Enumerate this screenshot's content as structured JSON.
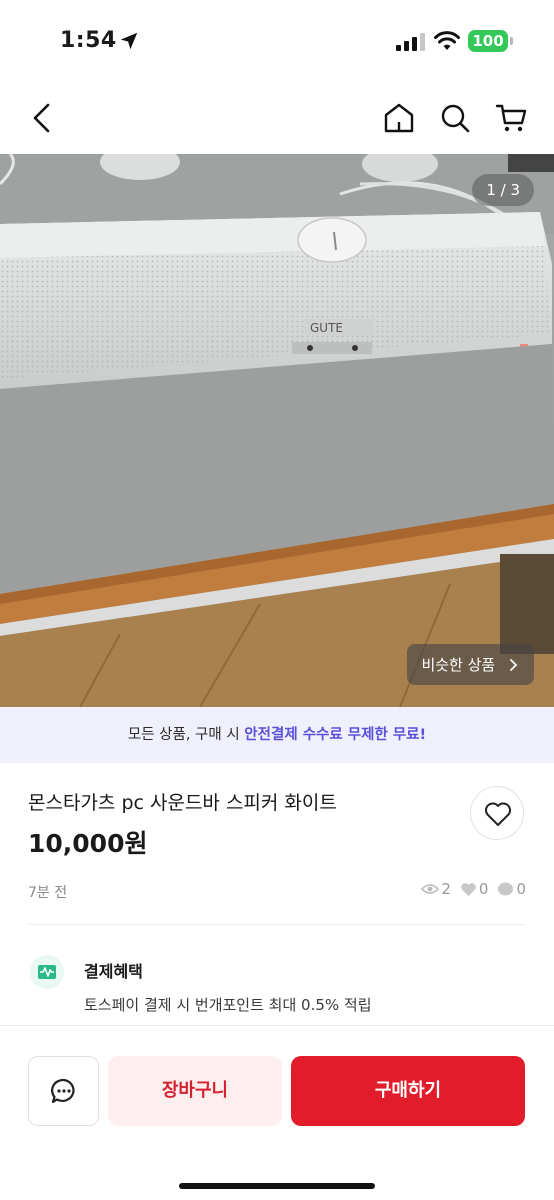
{
  "status_bar": {
    "time": "1:54",
    "battery": "100"
  },
  "nav": {
    "icons": [
      "back-icon",
      "home-icon",
      "search-icon",
      "cart-icon"
    ]
  },
  "gallery": {
    "counter": "1 / 3",
    "similar_label": "비슷한 상품"
  },
  "promo": {
    "prefix": "모든 상품, 구매 시 ",
    "highlight": "안전결제 수수료 무제한 무료!"
  },
  "product": {
    "title": "몬스타가츠 pc 사운드바 스피커 화이트",
    "price": "10,000원",
    "posted": "7분 전",
    "views": "2",
    "likes": "0",
    "chats": "0"
  },
  "benefit": {
    "title": "결제혜택",
    "description": "토스페이 결제 시 번개포인트 최대 0.5% 적립"
  },
  "bottom": {
    "cart_label": "장바구니",
    "buy_label": "구매하기"
  },
  "colors": {
    "accent": "#e11d2c",
    "promo_accent": "#5b4fd9",
    "battery": "#34c759"
  }
}
